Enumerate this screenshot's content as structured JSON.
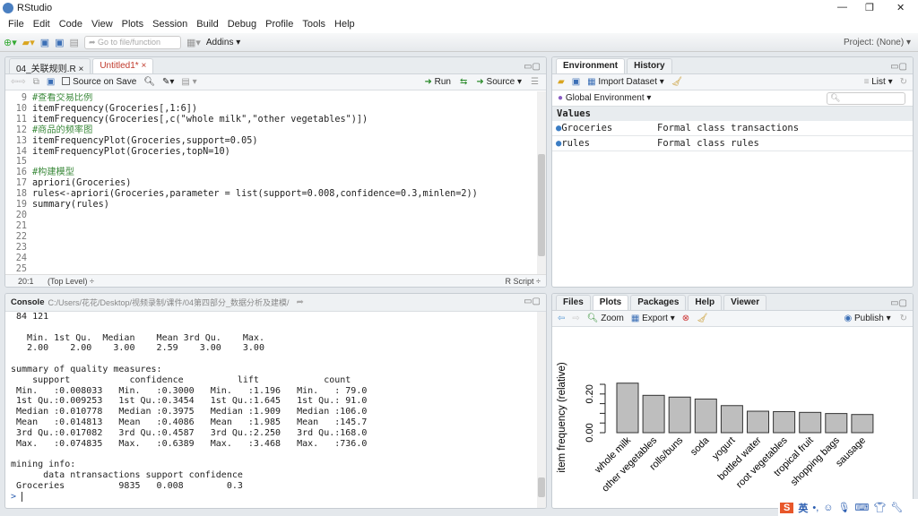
{
  "window": {
    "title": "RStudio",
    "minimize": "—",
    "maximize": "❐",
    "close": "✕"
  },
  "menu": [
    "File",
    "Edit",
    "Code",
    "View",
    "Plots",
    "Session",
    "Build",
    "Debug",
    "Profile",
    "Tools",
    "Help"
  ],
  "toolbar": {
    "goto_placeholder": "Go to file/function",
    "addins": "Addins ▾",
    "project": "Project: (None) ▾"
  },
  "source": {
    "tabs": [
      {
        "label": "04_关联规则.R"
      },
      {
        "label": "Untitled1*"
      }
    ],
    "source_on_save": "Source on Save",
    "run": "Run",
    "source_btn": "Source",
    "lines": [
      {
        "n": "9",
        "text": "#查看交易比例",
        "type": "comment"
      },
      {
        "n": "10",
        "text": "itemFrequency(Groceries[,1:6])",
        "type": "code"
      },
      {
        "n": "11",
        "text": "itemFrequency(Groceries[,c(\"whole milk\",\"other vegetables\")])",
        "type": "code"
      },
      {
        "n": "12",
        "text": "#商品的频率图",
        "type": "comment"
      },
      {
        "n": "13",
        "text": "itemFrequencyPlot(Groceries,support=0.05)",
        "type": "code"
      },
      {
        "n": "14",
        "text": "itemFrequencyPlot(Groceries,topN=10)",
        "type": "code"
      },
      {
        "n": "15",
        "text": "",
        "type": "code"
      },
      {
        "n": "16",
        "text": "#构建模型",
        "type": "comment"
      },
      {
        "n": "17",
        "text": "apriori(Groceries)",
        "type": "code"
      },
      {
        "n": "18",
        "text": "rules<-apriori(Groceries,parameter = list(support=0.008,confidence=0.3,minlen=2))",
        "type": "code"
      },
      {
        "n": "19",
        "text": "summary(rules)",
        "type": "code"
      },
      {
        "n": "20",
        "text": "",
        "type": "code"
      },
      {
        "n": "21",
        "text": "",
        "type": "code"
      },
      {
        "n": "22",
        "text": "",
        "type": "code"
      },
      {
        "n": "23",
        "text": "",
        "type": "code"
      },
      {
        "n": "24",
        "text": "",
        "type": "code"
      },
      {
        "n": "25",
        "text": "",
        "type": "code"
      }
    ],
    "status_pos": "20:1",
    "status_level": "(Top Level) ÷",
    "status_type": "R Script ÷"
  },
  "console": {
    "title": "Console",
    "path": "C:/Users/花花/Desktop/视频录制/课件/04第四部分_数据分析及建模/",
    "lines": [
      " 84 121",
      "",
      "   Min. 1st Qu.  Median    Mean 3rd Qu.    Max. ",
      "   2.00    2.00    3.00    2.59    3.00    3.00 ",
      "",
      "summary of quality measures:",
      "    support           confidence          lift            count      ",
      " Min.   :0.008033   Min.   :0.3000   Min.   :1.196   Min.   : 79.0  ",
      " 1st Qu.:0.009253   1st Qu.:0.3454   1st Qu.:1.645   1st Qu.: 91.0  ",
      " Median :0.010778   Median :0.3975   Median :1.909   Median :106.0  ",
      " Mean   :0.014813   Mean   :0.4086   Mean   :1.985   Mean   :145.7  ",
      " 3rd Qu.:0.017082   3rd Qu.:0.4587   3rd Qu.:2.250   3rd Qu.:168.0  ",
      " Max.   :0.074835   Max.   :0.6389   Max.   :3.468   Max.   :736.0  ",
      "",
      "mining info:",
      "      data ntransactions support confidence",
      " Groceries          9835   0.008        0.3"
    ],
    "prompt": ">"
  },
  "environment": {
    "tabs": [
      "Environment",
      "History"
    ],
    "import": "Import Dataset ▾",
    "list": "List ▾",
    "scope": "Global Environment ▾",
    "section": "Values",
    "rows": [
      {
        "name": "Groceries",
        "value": "Formal class transactions"
      },
      {
        "name": "rules",
        "value": "Formal class rules"
      }
    ]
  },
  "files": {
    "tabs": [
      "Files",
      "Plots",
      "Packages",
      "Help",
      "Viewer"
    ],
    "zoom": "Zoom",
    "export": "Export ▾",
    "publish": "Publish ▾"
  },
  "ime": {
    "lang": "英"
  },
  "chart_data": {
    "type": "bar",
    "categories": [
      "whole milk",
      "other vegetables",
      "rolls/buns",
      "soda",
      "yogurt",
      "bottled water",
      "root vegetables",
      "tropical fruit",
      "shopping bags",
      "sausage"
    ],
    "values": [
      0.256,
      0.193,
      0.184,
      0.174,
      0.14,
      0.111,
      0.109,
      0.105,
      0.099,
      0.094
    ],
    "ylabel": "item frequency (relative)",
    "yticks": [
      0,
      0.05,
      0.1,
      0.15,
      0.2,
      0.25
    ],
    "ytick_labels": [
      "0.00",
      "0.20"
    ],
    "ylim": [
      0,
      0.25
    ],
    "bar_color": "#bebebe"
  }
}
